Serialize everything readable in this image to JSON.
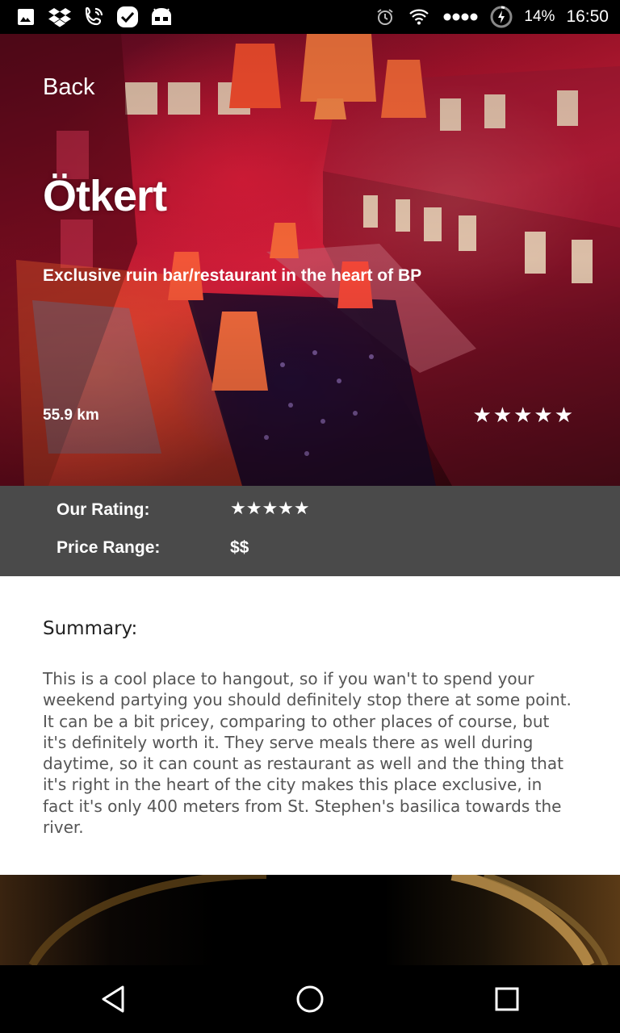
{
  "status_bar": {
    "battery_percent": "14%",
    "time": "16:50",
    "left_icons": [
      "gallery-icon",
      "dropbox-icon",
      "wifi-calling-icon",
      "tasks-check-icon",
      "android-bot-icon"
    ],
    "right_icons": [
      "alarm-icon",
      "wifi-icon",
      "signal-dots-icon",
      "battery-charging-icon"
    ]
  },
  "hero": {
    "back_label": "Back",
    "title": "Ötkert",
    "subtitle": "Exclusive ruin bar/restaurant in the heart of BP",
    "distance": "55.9 km",
    "stars": "★★★★★",
    "star_rating": 5
  },
  "info": {
    "rating_label": "Our Rating:",
    "rating_stars": "★★★★★",
    "price_label": "Price Range:",
    "price_value": "$$"
  },
  "summary": {
    "title": "Summary:",
    "text": "This is a cool place to hangout, so if you wan't to spend your weekend partying you should definitely stop there at some point. It can be a bit pricey, comparing to other places of course, but it's definitely worth it. They serve meals there as well during daytime, so it can count as restaurant as well and the thing that it's right in the heart of the city makes this place exclusive, in fact it's only 400 meters from St. Stephen's basilica  towards the river."
  },
  "nav_bar": {
    "buttons": [
      "back-nav-icon",
      "home-nav-icon",
      "recents-nav-icon"
    ]
  },
  "colors": {
    "info_band": "#4a4a4a",
    "summary_text": "#555555"
  }
}
